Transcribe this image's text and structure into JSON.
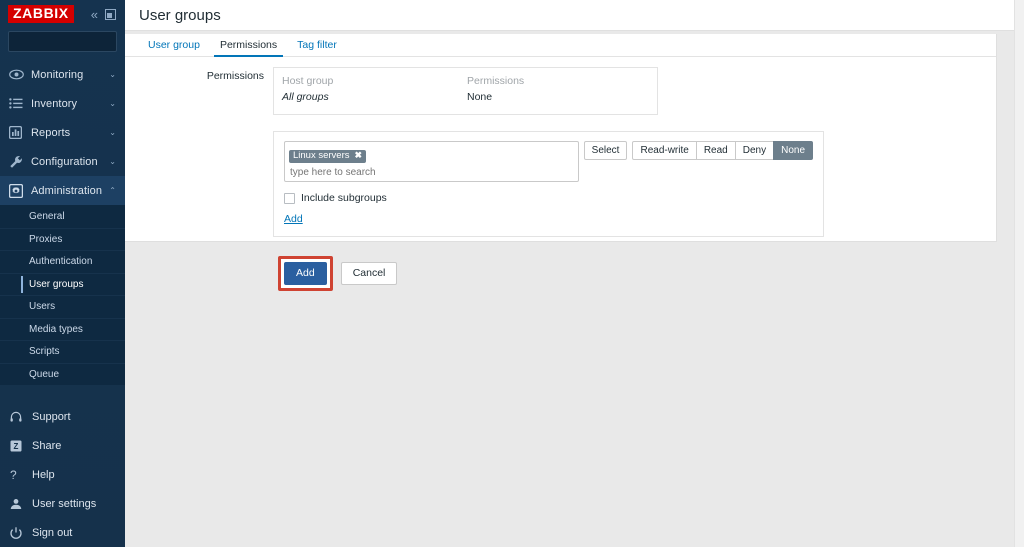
{
  "sidebar": {
    "logo": "ZABBIX",
    "collapse_icon": "chevron-double-left-icon",
    "compact_icon": "compact-view-icon",
    "search": {
      "value": "",
      "placeholder": ""
    },
    "nav": [
      {
        "label": "Monitoring",
        "icon": "eye-icon",
        "chevron": "⌄",
        "expanded": false
      },
      {
        "label": "Inventory",
        "icon": "list-icon",
        "chevron": "⌄",
        "expanded": false
      },
      {
        "label": "Reports",
        "icon": "bar-chart-icon",
        "chevron": "⌄",
        "expanded": false
      },
      {
        "label": "Configuration",
        "icon": "wrench-icon",
        "chevron": "⌄",
        "expanded": false
      },
      {
        "label": "Administration",
        "icon": "gear-icon",
        "chevron": "⌃",
        "expanded": true
      }
    ],
    "submenu": [
      {
        "label": "General",
        "active": false
      },
      {
        "label": "Proxies",
        "active": false
      },
      {
        "label": "Authentication",
        "active": false
      },
      {
        "label": "User groups",
        "active": true
      },
      {
        "label": "Users",
        "active": false
      },
      {
        "label": "Media types",
        "active": false
      },
      {
        "label": "Scripts",
        "active": false
      },
      {
        "label": "Queue",
        "active": false
      }
    ],
    "bottom": [
      {
        "label": "Support",
        "icon": "headset-icon"
      },
      {
        "label": "Share",
        "icon": "zabbix-share-icon"
      },
      {
        "label": "Help",
        "icon": "question-mark-icon"
      },
      {
        "label": "User settings",
        "icon": "user-icon"
      },
      {
        "label": "Sign out",
        "icon": "power-icon"
      }
    ]
  },
  "header": {
    "title": "User groups"
  },
  "tabs": [
    {
      "label": "User group",
      "active": false
    },
    {
      "label": "Permissions",
      "active": true
    },
    {
      "label": "Tag filter",
      "active": false
    }
  ],
  "form": {
    "permissions_label": "Permissions",
    "table": {
      "headers": [
        "Host group",
        "Permissions"
      ],
      "rows": [
        {
          "host_group": "All groups",
          "permission": "None"
        }
      ]
    },
    "editor": {
      "chips": [
        {
          "label": "Linux servers",
          "remove_icon": "✖"
        }
      ],
      "input_placeholder": "type here to search",
      "input_value": "",
      "select_button": "Select",
      "permission_options": [
        {
          "label": "Read-write",
          "selected": false
        },
        {
          "label": "Read",
          "selected": false
        },
        {
          "label": "Deny",
          "selected": false
        },
        {
          "label": "None",
          "selected": true
        }
      ],
      "include_subgroups": {
        "label": "Include subgroups",
        "checked": false
      },
      "add_link": "Add"
    },
    "actions": {
      "submit": "Add",
      "cancel": "Cancel"
    }
  },
  "colors": {
    "brand_red": "#d40000",
    "sidebar_bg": "#15314b",
    "link_blue": "#0275b8",
    "primary_button": "#2a5fa0",
    "selected_segment": "#6d7f8c",
    "highlight_box": "#cf4332"
  }
}
